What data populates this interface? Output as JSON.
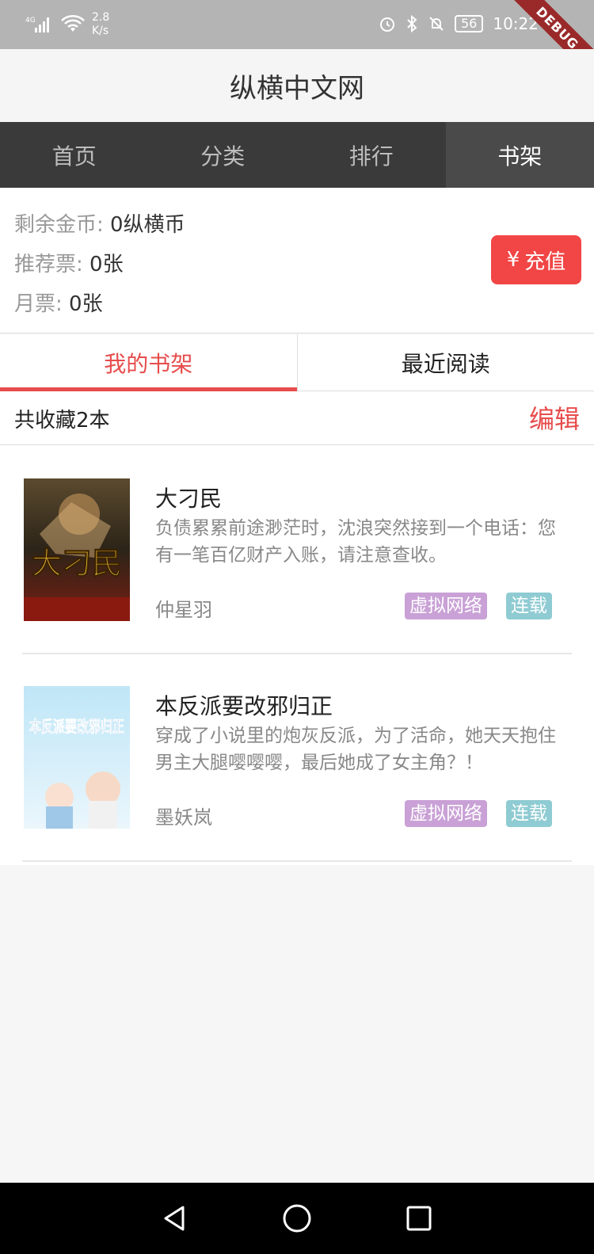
{
  "status_bar": {
    "network": "4G",
    "speed": "2.8\nK/s",
    "battery": "56",
    "time": "10:22",
    "debug": "DEBUG"
  },
  "app_title": "纵横中文网",
  "nav_tabs": [
    {
      "label": "首页",
      "active": false
    },
    {
      "label": "分类",
      "active": false
    },
    {
      "label": "排行",
      "active": false
    },
    {
      "label": "书架",
      "active": true
    }
  ],
  "account": {
    "coins_label": "剩余金币:",
    "coins_value": "0纵横币",
    "rec_label": "推荐票:",
    "rec_value": "0张",
    "month_label": "月票:",
    "month_value": "0张",
    "recharge_label": "充值",
    "recharge_symbol": "¥"
  },
  "sub_tabs": [
    {
      "label": "我的书架",
      "active": true
    },
    {
      "label": "最近阅读",
      "active": false
    }
  ],
  "collection": {
    "count_text": "共收藏2本",
    "edit_label": "编辑"
  },
  "books": [
    {
      "title": "大刁民",
      "desc": "负债累累前途渺茫时，沈浪突然接到一个电话：您有一笔百亿财产入账，请注意查收。",
      "author": "仲星羽",
      "genre": "虚拟网络",
      "status": "连载",
      "cover_text": "大刁民"
    },
    {
      "title": "本反派要改邪归正",
      "desc": "穿成了小说里的炮灰反派，为了活命，她天天抱住男主大腿嘤嘤嘤，最后她成了女主角？！",
      "author": "墨妖岚",
      "genre": "虚拟网络",
      "status": "连载",
      "cover_text": "本反派要改邪归正"
    }
  ],
  "colors": {
    "accent": "#e74c4c",
    "nav_bg": "#3a3a3a",
    "genre_tag": "#c9a1d6",
    "status_tag": "#8fcbd2"
  }
}
